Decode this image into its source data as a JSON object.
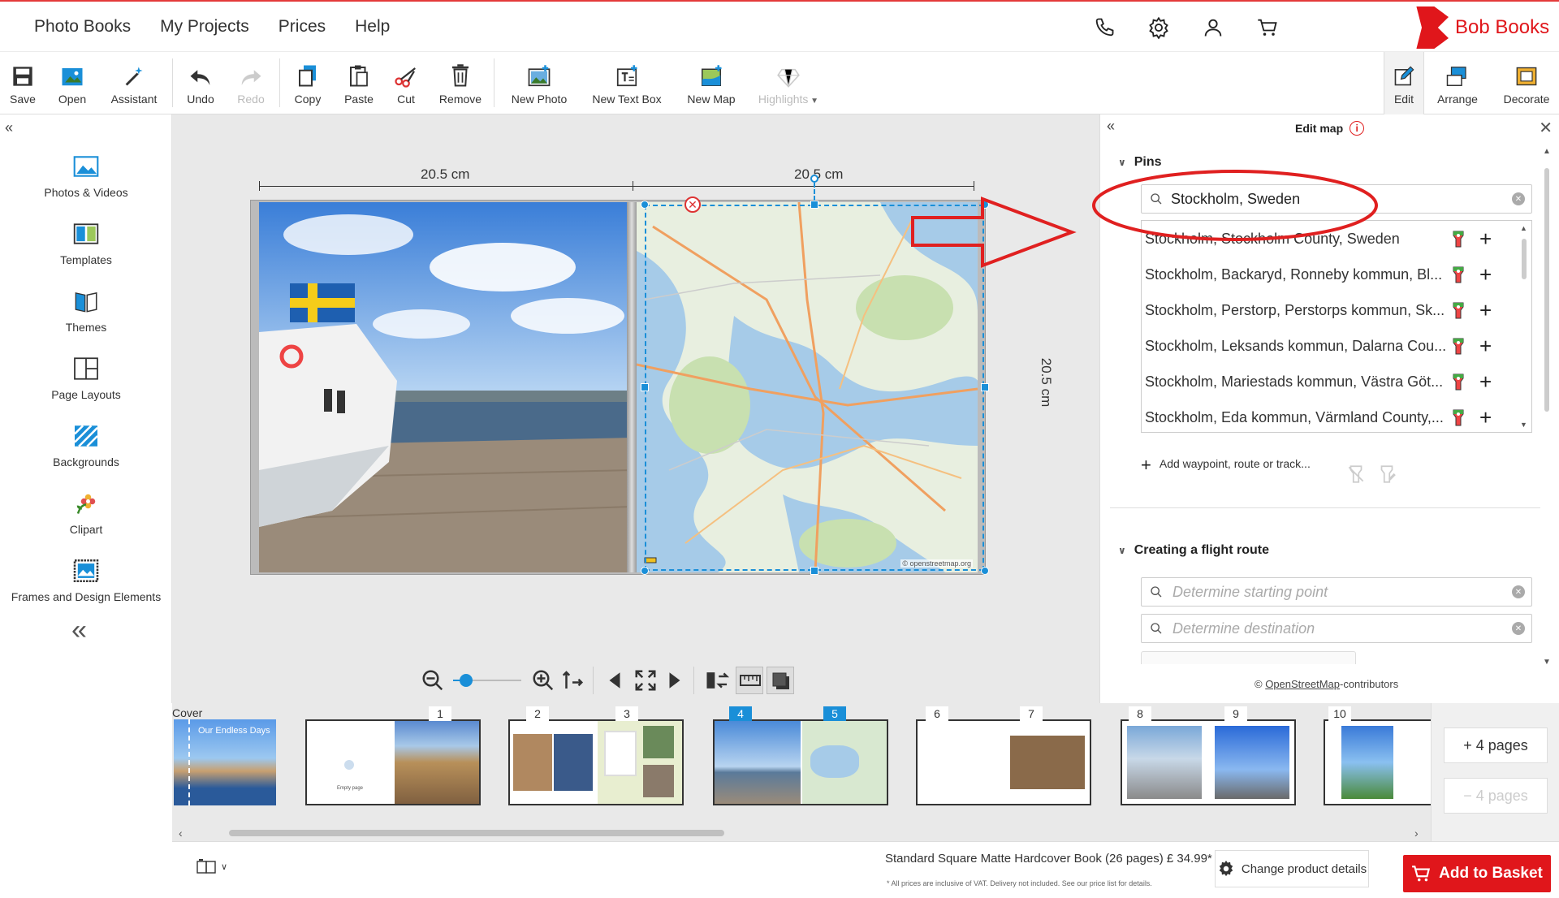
{
  "topnav": [
    "Photo Books",
    "My Projects",
    "Prices",
    "Help"
  ],
  "brand": {
    "name": "Bob Books",
    "color": "#e0161b"
  },
  "toolbar": {
    "save": "Save",
    "open": "Open",
    "assistant": "Assistant",
    "undo": "Undo",
    "redo": "Redo",
    "copy": "Copy",
    "paste": "Paste",
    "cut": "Cut",
    "remove": "Remove",
    "new_photo": "New Photo",
    "new_text_box": "New Text Box",
    "new_map": "New Map",
    "highlights": "Highlights",
    "edit": "Edit",
    "arrange": "Arrange",
    "decorate": "Decorate"
  },
  "sidebar": {
    "items": [
      "Photos & Videos",
      "Templates",
      "Themes",
      "Page Layouts",
      "Backgrounds",
      "Clipart",
      "Frames and Design Elements"
    ]
  },
  "canvas": {
    "width_left": "20.5 cm",
    "width_right": "20.5 cm",
    "height": "20.5 cm",
    "map_credit": "© openstreetmap.org"
  },
  "panel": {
    "title": "Edit map",
    "pins_heading": "Pins",
    "search_value": "Stockholm, Sweden",
    "results": [
      "Stockholm, Stockholm County, Sweden",
      "Stockholm, Backaryd, Ronneby kommun, Bl...",
      "Stockholm, Perstorp, Perstorps kommun, Sk...",
      "Stockholm, Leksands kommun, Dalarna Cou...",
      "Stockholm, Mariestads kommun, Västra Göt...",
      "Stockholm, Eda kommun, Värmland County,..."
    ],
    "add_waypoint": "Add waypoint, route or track...",
    "flight_heading": "Creating a flight route",
    "start_placeholder": "Determine starting point",
    "dest_placeholder": "Determine destination",
    "osm_prefix": "© ",
    "osm_link": "OpenStreetMap",
    "osm_suffix": "-contributors"
  },
  "pages": {
    "cover_label": "Cover",
    "cover_title": "Our Endless Days",
    "empty_page": "Empty page",
    "numbers": [
      "1",
      "2",
      "3",
      "4",
      "5",
      "6",
      "7",
      "8",
      "9",
      "10"
    ],
    "add_pages": "+ 4 pages",
    "remove_pages": "− 4 pages"
  },
  "footer": {
    "product": "Standard Square Matte Hardcover Book (26 pages) £ 34.99*",
    "vat_note": "* All prices are inclusive of VAT. Delivery not included. See our price list for details.",
    "change_details": "Change product details",
    "add_basket": "Add to Basket"
  },
  "colors": {
    "accent": "#1a8fd8",
    "annotation": "#e02020",
    "basket": "#e0161b"
  }
}
